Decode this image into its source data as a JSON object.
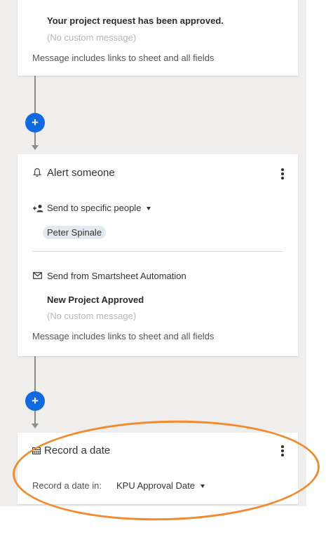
{
  "card_approved": {
    "heading": "Your project request has been approved.",
    "custom_message": "(No custom message)",
    "links_note": "Message includes links to sheet and all fields"
  },
  "add_step_label": "+",
  "card_alert": {
    "title": "Alert someone",
    "send_mode": "Send to specific people",
    "recipient": "Peter Spinale",
    "sender": "Send from Smartsheet Automation",
    "subject": "New Project Approved",
    "custom_message": "(No custom message)",
    "links_note": "Message includes links to sheet and all fields"
  },
  "card_record": {
    "title": "Record a date",
    "field_label": "Record a date in:",
    "field_value": "KPU Approval Date"
  },
  "colors": {
    "accent": "#1169e0",
    "highlight": "#f28a2f",
    "canvas": "#efeeed"
  }
}
